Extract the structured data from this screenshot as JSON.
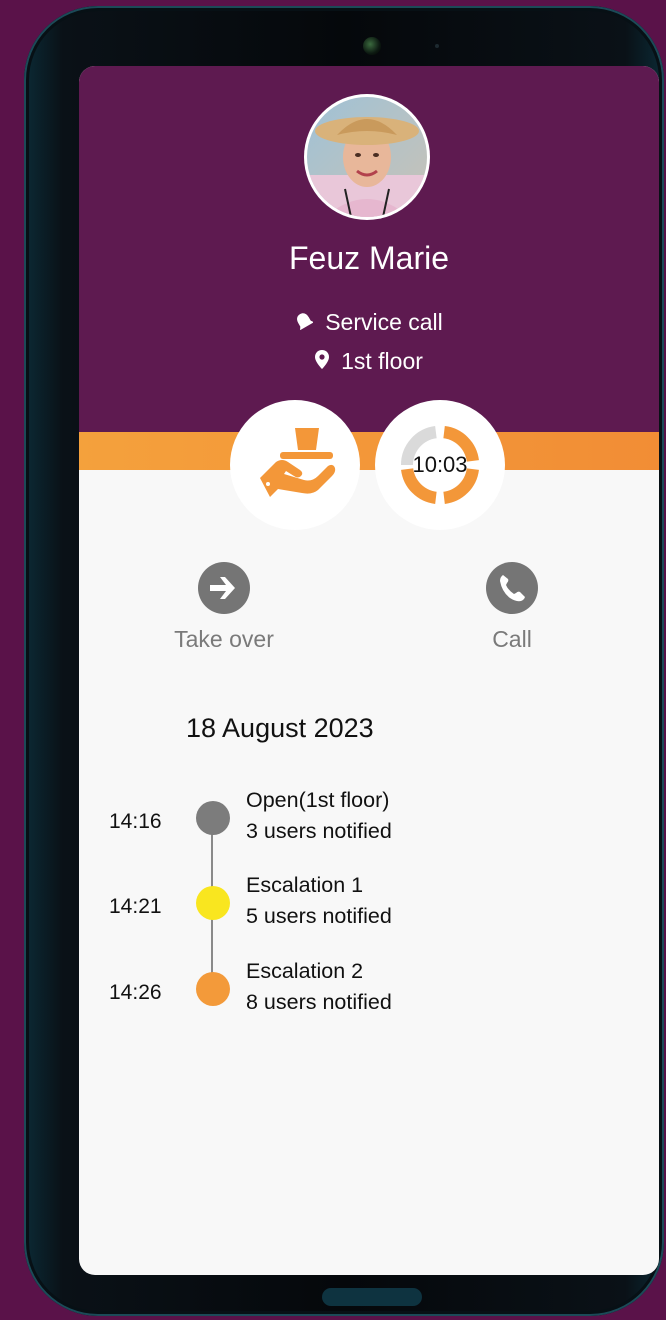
{
  "caller": {
    "name": "Feuz Marie",
    "call_type": "Service call",
    "location": "1st floor"
  },
  "timer": {
    "value": "10:03",
    "elapsed_fraction": 0.8
  },
  "actions": {
    "take_over_label": "Take over",
    "call_label": "Call"
  },
  "history": {
    "date": "18 August 2023",
    "events": [
      {
        "time": "14:16",
        "title": "Open(1st floor)",
        "detail": "3 users notified",
        "color": "#7c7c7c"
      },
      {
        "time": "14:21",
        "title": "Escalation 1",
        "detail": "5 users notified",
        "color": "#f9e61f"
      },
      {
        "time": "14:26",
        "title": "Escalation 2",
        "detail": "8 users notified",
        "color": "#f39a3a"
      }
    ]
  },
  "colors": {
    "brand_purple": "#5e1a50",
    "accent_orange": "#f39739",
    "icon_gray": "#757575"
  }
}
